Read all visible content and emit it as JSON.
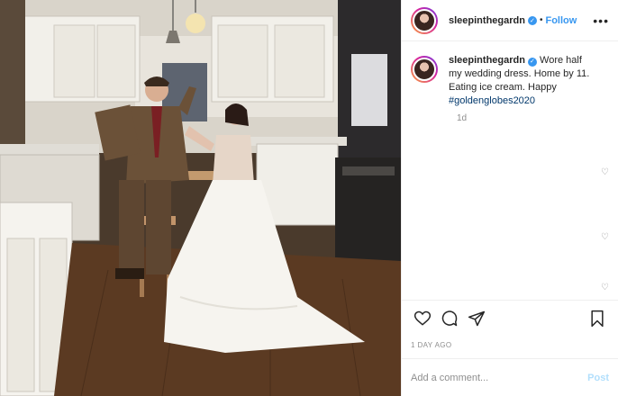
{
  "header": {
    "username": "sleepinthegardn",
    "separator": "•",
    "follow_label": "Follow",
    "more_label": "•••"
  },
  "caption": {
    "username": "sleepinthegardn",
    "text": "Wore half my wedding dress. Home by 11. Eating ice cream. Happy ",
    "hashtag": "#goldenglobes2020",
    "time": "1d"
  },
  "stamp": "1 DAY AGO",
  "comment_box": {
    "placeholder": "Add a comment...",
    "post_label": "Post"
  },
  "icons": {
    "like": "heart-icon",
    "comment": "comment-icon",
    "share": "paper-plane-icon",
    "save": "bookmark-icon",
    "verified": "verified-badge-icon"
  },
  "colors": {
    "link": "#3897f0",
    "hashtag": "#00376b",
    "muted": "#8e8e8e",
    "post_disabled": "#b2dffc"
  }
}
